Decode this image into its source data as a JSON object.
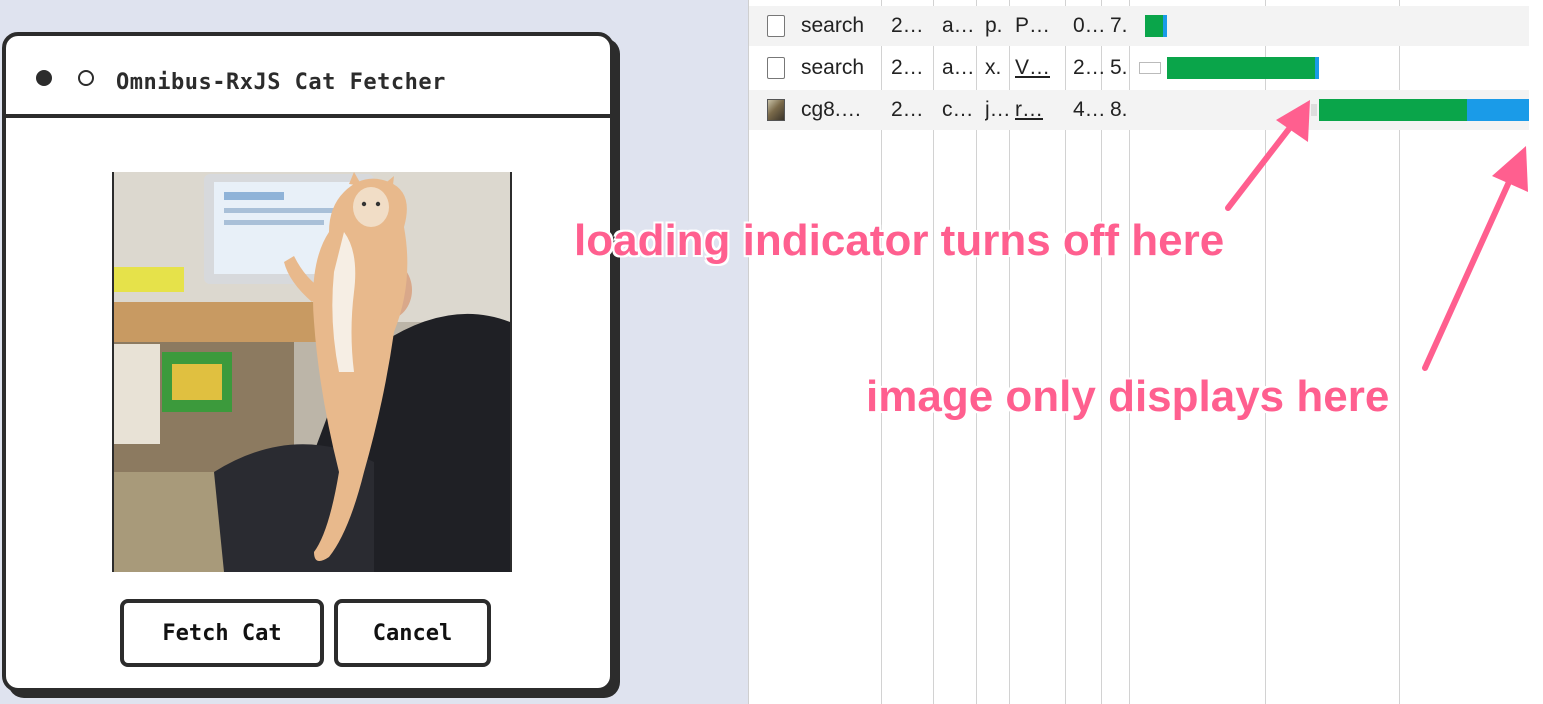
{
  "window": {
    "title": "Omnibus-RxJS Cat Fetcher",
    "buttons": {
      "fetch": "Fetch Cat",
      "cancel": "Cancel"
    }
  },
  "network": {
    "rows": [
      {
        "name": "search",
        "c1": "2…",
        "c2": "a…",
        "c3": "p.",
        "c4": "P…",
        "c5": "0…",
        "c6": "7.",
        "icon": "document-icon"
      },
      {
        "name": "search",
        "c1": "2…",
        "c2": "a…",
        "c3": "x.",
        "c4": "V…",
        "c5": "2…",
        "c6": "5.",
        "icon": "document-icon"
      },
      {
        "name": "cg8.…",
        "c1": "2…",
        "c2": "c…",
        "c3": "j…",
        "c4": "r…",
        "c5": "4…",
        "c6": "8.",
        "icon": "image-thumbnail-icon"
      }
    ]
  },
  "annotations": {
    "loading": "loading indicator turns off here",
    "image": "image only displays here"
  },
  "colors": {
    "accent": "#ff5f8f",
    "bar_green": "#0aa54a",
    "bar_blue": "#1a9be8",
    "frame": "#2c2c2c"
  }
}
